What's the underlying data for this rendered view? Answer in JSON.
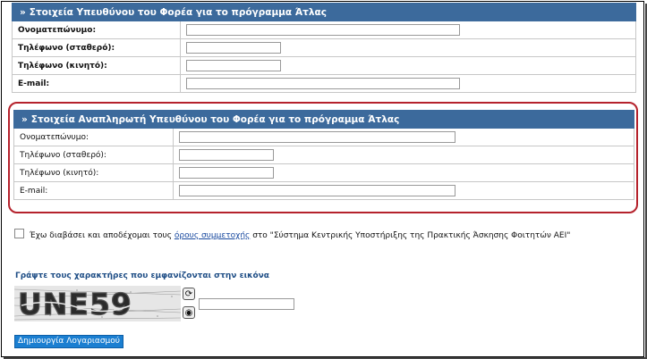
{
  "section1": {
    "title": "Στοιχεία Υπευθύνου του Φορέα για το πρόγραμμα Άτλας",
    "fields": [
      {
        "label": "Ονοματεπώνυμο:",
        "value": ""
      },
      {
        "label": "Τηλέφωνο (σταθερό):",
        "value": ""
      },
      {
        "label": "Τηλέφωνο (κινητό):",
        "value": ""
      },
      {
        "label": "E-mail:",
        "value": ""
      }
    ]
  },
  "section2": {
    "title": "Στοιχεία Αναπληρωτή Υπευθύνου του Φορέα για το πρόγραμμα Άτλας",
    "fields": [
      {
        "label": "Ονοματεπώνυμο:",
        "value": ""
      },
      {
        "label": "Τηλέφωνο (σταθερό):",
        "value": ""
      },
      {
        "label": "Τηλέφωνο (κινητό):",
        "value": ""
      },
      {
        "label": "E-mail:",
        "value": ""
      }
    ]
  },
  "header_marker": "»",
  "terms": {
    "checked": false,
    "before": "Έχω διαβάσει και αποδέχομαι τους",
    "link": "όρους συμμετοχής",
    "after": "στο \"Σύστημα Κεντρικής Υποστήριξης της Πρακτικής Άσκησης Φοιτητών ΑΕΙ\""
  },
  "captcha": {
    "title": "Γράψτε τους χαρακτήρες που εμφανίζονται στην εικόνα",
    "image_text": "UNE59",
    "refresh_icon": "refresh-icon",
    "audio_icon": "audio-icon",
    "input_value": ""
  },
  "submit_label": "Δημιουργία Λογαριασμού",
  "colors": {
    "header_bg": "#3c6a9c",
    "highlight_border": "#b5222c",
    "button_bg": "#1b7fd1",
    "captcha_title": "#1f4e86"
  }
}
